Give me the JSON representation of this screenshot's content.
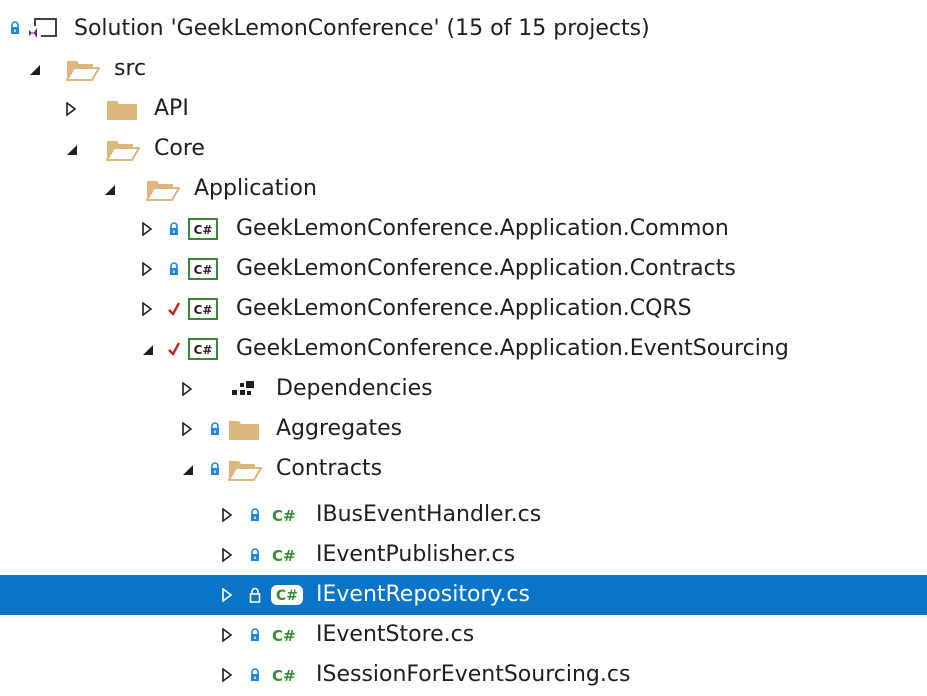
{
  "solution_explorer": {
    "rows": [
      {
        "label": "Solution 'GeekLemonConference' (15 of 15 projects)",
        "icon": "solution-icon",
        "expander": "none",
        "status": "lock"
      },
      {
        "label": "src",
        "icon": "folder-open-icon",
        "expander": "expanded",
        "status": "none"
      },
      {
        "label": "API",
        "icon": "folder-closed-icon",
        "expander": "collapsed",
        "status": "none"
      },
      {
        "label": "Core",
        "icon": "folder-open-icon",
        "expander": "expanded",
        "status": "none"
      },
      {
        "label": "Application",
        "icon": "folder-open-icon",
        "expander": "expanded",
        "status": "none"
      },
      {
        "label": "GeekLemonConference.Application.Common",
        "icon": "csharp-project-icon",
        "expander": "collapsed",
        "status": "lock"
      },
      {
        "label": "GeekLemonConference.Application.Contracts",
        "icon": "csharp-project-icon",
        "expander": "collapsed",
        "status": "lock"
      },
      {
        "label": "GeekLemonConference.Application.CQRS",
        "icon": "csharp-project-icon",
        "expander": "collapsed",
        "status": "check"
      },
      {
        "label": "GeekLemonConference.Application.EventSourcing",
        "icon": "csharp-project-icon",
        "expander": "expanded",
        "status": "check"
      },
      {
        "label": "Dependencies",
        "icon": "dependencies-icon",
        "expander": "collapsed",
        "status": "none"
      },
      {
        "label": "Aggregates",
        "icon": "folder-closed-icon",
        "expander": "collapsed",
        "status": "lock"
      },
      {
        "label": "Contracts",
        "icon": "folder-open-icon",
        "expander": "expanded",
        "status": "lock"
      },
      {
        "label": "IBusEventHandler.cs",
        "icon": "csharp-file-icon",
        "expander": "collapsed",
        "status": "lock"
      },
      {
        "label": "IEventPublisher.cs",
        "icon": "csharp-file-icon",
        "expander": "collapsed",
        "status": "lock"
      },
      {
        "label": "IEventRepository.cs",
        "icon": "csharp-file-icon",
        "expander": "collapsed",
        "status": "lock",
        "selected": true
      },
      {
        "label": "IEventStore.cs",
        "icon": "csharp-file-icon",
        "expander": "collapsed",
        "status": "lock"
      },
      {
        "label": "ISessionForEventSourcing.cs",
        "icon": "csharp-file-icon",
        "expander": "collapsed",
        "status": "lock"
      }
    ]
  },
  "colors": {
    "selection": "#0a74c8",
    "folder": "#dcb67a",
    "csharp_green": "#388a34",
    "lock_blue": "#1e88e5",
    "check_red": "#d11b1b"
  }
}
